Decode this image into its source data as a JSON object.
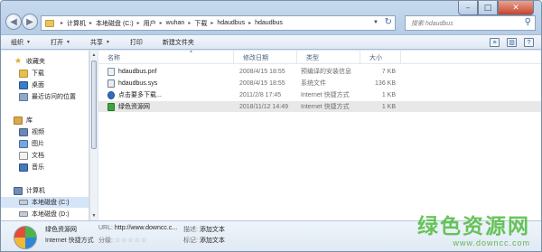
{
  "caption": {
    "minimize": "–",
    "maximize": "□",
    "close": "✕"
  },
  "nav": {
    "back": "◀",
    "forward": "▶"
  },
  "address": {
    "crumbs": [
      "计算机",
      "本地磁盘 (C:)",
      "用户",
      "wuhan",
      "下载",
      "hdaudbus",
      "hdaudbus"
    ],
    "first_sep": "▸",
    "sep": "▸",
    "dropdown": "▼",
    "refresh": "↻"
  },
  "search": {
    "placeholder": "搜索 hdaudbus",
    "icon": "search-icon",
    "glyph": "⚲"
  },
  "toolbar": {
    "organize": "组织",
    "open": "打开",
    "share": "共享",
    "print": "打印",
    "new_folder": "新建文件夹",
    "dd": "▼"
  },
  "toolbar_icons": {
    "view": "≡",
    "preview": "▥",
    "help": "?"
  },
  "sidebar": {
    "items": [
      {
        "label": "收藏夹",
        "icon": "star-icon",
        "glyph": "★"
      },
      {
        "label": "下载",
        "icon": "download-folder-icon"
      },
      {
        "label": "桌面",
        "icon": "desktop-icon"
      },
      {
        "label": "最近访问的位置",
        "icon": "recent-places-icon"
      },
      {
        "label": "库",
        "icon": "library-icon"
      },
      {
        "label": "视频",
        "icon": "video-icon"
      },
      {
        "label": "图片",
        "icon": "pictures-icon"
      },
      {
        "label": "文档",
        "icon": "documents-icon"
      },
      {
        "label": "音乐",
        "icon": "music-icon"
      },
      {
        "label": "计算机",
        "icon": "computer-icon"
      },
      {
        "label": "本地磁盘 (C:)",
        "icon": "drive-icon"
      },
      {
        "label": "本地磁盘 (D:)",
        "icon": "drive-icon"
      }
    ],
    "scroll_up": "▲",
    "scroll_down": "▼"
  },
  "columns": {
    "name": "名称",
    "date": "修改日期",
    "type": "类型",
    "size": "大小",
    "sort_indicator": "▲"
  },
  "files": [
    {
      "name": "hdaudbus.pnf",
      "date": "2008/4/15 18:55",
      "type": "预编译的安装信息",
      "size": "7 KB",
      "icon": "pnf-file-icon"
    },
    {
      "name": "hdaudbus.sys",
      "date": "2008/4/15 18:55",
      "type": "系统文件",
      "size": "136 KB",
      "icon": "sys-file-icon"
    },
    {
      "name": "点击要多下载...",
      "date": "2011/2/8 17:45",
      "type": "Internet 快捷方式",
      "size": "1 KB",
      "icon": "internet-shortcut-icon"
    },
    {
      "name": "绿色资源网",
      "date": "2018/11/12 14:49",
      "type": "Internet 快捷方式",
      "size": "1 KB",
      "icon": "internet-shortcut-icon"
    }
  ],
  "details": {
    "name": "绿色资源网",
    "kind": "Internet 快捷方式",
    "url_label": "URL:",
    "url_value": "http://www.downcc.c...",
    "rating_label": "分级:",
    "stars": "☆☆☆☆☆",
    "title_label": "描述:",
    "title_value": "添加文本",
    "tags_label": "标记:",
    "tags_value": "添加文本"
  },
  "watermark": {
    "cn": "绿色资源网",
    "url": "www.downcc.com"
  }
}
